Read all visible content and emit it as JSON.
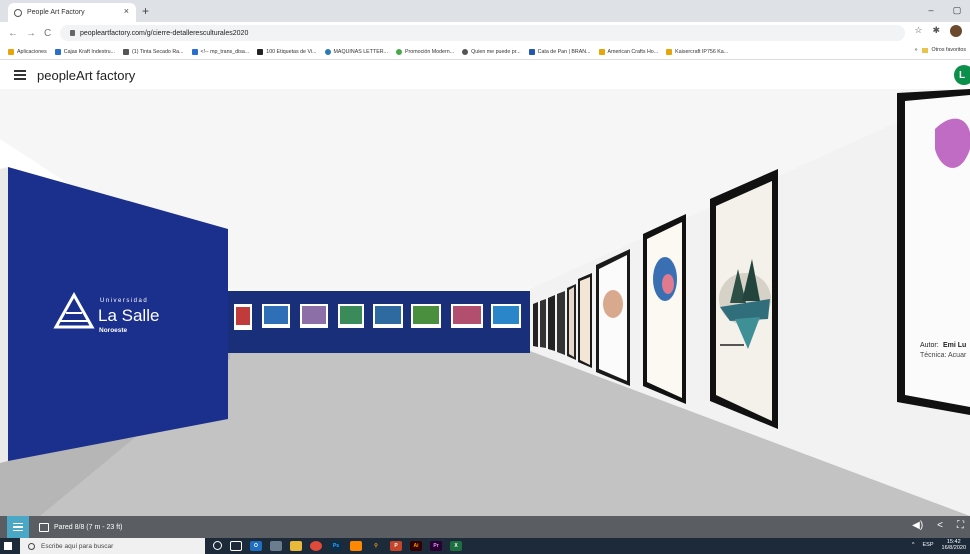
{
  "browser": {
    "tab_title": "People Art Factory",
    "tab_close": "×",
    "new_tab": "+",
    "url": "peopleartfactory.com/g/cierre-detalleresculturales2020",
    "window_controls": [
      "–",
      "▢"
    ]
  },
  "bookmarks": [
    {
      "label": "Aplicaciones",
      "color": "#e8a50a"
    },
    {
      "label": "Cajas Kraft Indestru...",
      "color": "#2b6fce"
    },
    {
      "label": "(1) Tinta Secado Ra...",
      "color": "#555555"
    },
    {
      "label": "<!-- mp_trans_disa...",
      "color": "#2b6fce"
    },
    {
      "label": "100 Etiquetas de Vi...",
      "color": "#222222"
    },
    {
      "label": "MAQUINAS LETTER...",
      "color": "#2a7ab8"
    },
    {
      "label": "Promoción Modern...",
      "color": "#4aa84a"
    },
    {
      "label": "Quien me puede pr...",
      "color": "#555555"
    },
    {
      "label": "Cata de Pan | BRAN...",
      "color": "#2456b5"
    },
    {
      "label": "American Crafts Ho...",
      "color": "#e8a50a"
    },
    {
      "label": "Kaisercraft IP756 Ka...",
      "color": "#e8a50a"
    }
  ],
  "bookmarks_more": "»",
  "bookmarks_other": "Otros favoritos",
  "app": {
    "brand": "peopleArt factory",
    "user_initial": "L"
  },
  "gallery": {
    "logo_top": "Universidad",
    "logo_main": "La Salle",
    "logo_sub": "Noroeste",
    "artwork_author_label": "Autor:",
    "artwork_author_name": "Emi Lu",
    "artwork_technique": "Técnica: Acuar"
  },
  "bottom": {
    "wall_label": "Pared 8/8 (7 m - 23 ft)"
  },
  "taskbar": {
    "search_placeholder": "Escribe aquí para buscar",
    "lang": "ESP",
    "time": "15:42",
    "date": "16/8/2020",
    "tray_arrow": "^"
  },
  "colors": {
    "accent_blue": "#1b2f8c",
    "mural_blue": "#1a2f7a",
    "app_bar": "#5a5e62",
    "menu_button": "#4aa8c6",
    "user_badge": "#0b8f4a",
    "taskbar": "#1c2a3a"
  }
}
